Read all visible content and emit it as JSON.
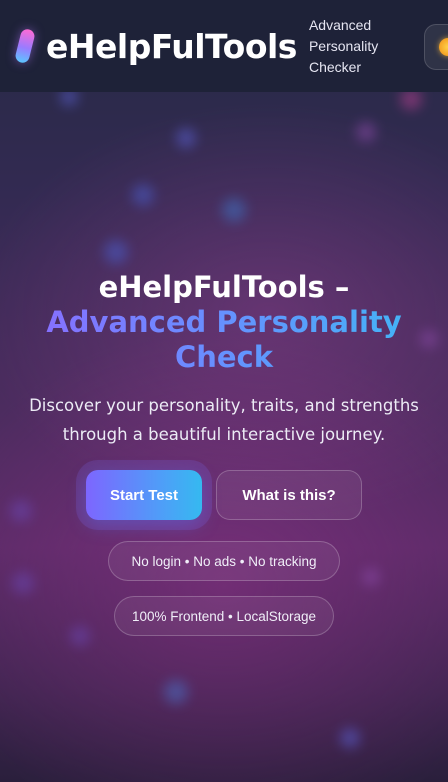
{
  "header": {
    "brand": "eHelpFulTools",
    "nav_lines": [
      "Advanced",
      "Personality",
      "Checker"
    ],
    "logo_icon": "gradient-pill-logo",
    "theme_icon": "sun-icon"
  },
  "hero": {
    "title_line1": "eHelpFulTools –",
    "title_gradient": "Advanced Personality Check",
    "subtitle": "Discover your personality, traits, and strengths through a beautiful interactive journey."
  },
  "actions": {
    "start_label": "Start Test",
    "info_label": "What is this?"
  },
  "badges": [
    "No login • No ads • No tracking",
    "100% Frontend • LocalStorage"
  ],
  "colors": {
    "header_bg": "#1e2238",
    "accent_start": "#7d66ff",
    "accent_end": "#35b9f0",
    "background_mid": "#5a2b67"
  }
}
